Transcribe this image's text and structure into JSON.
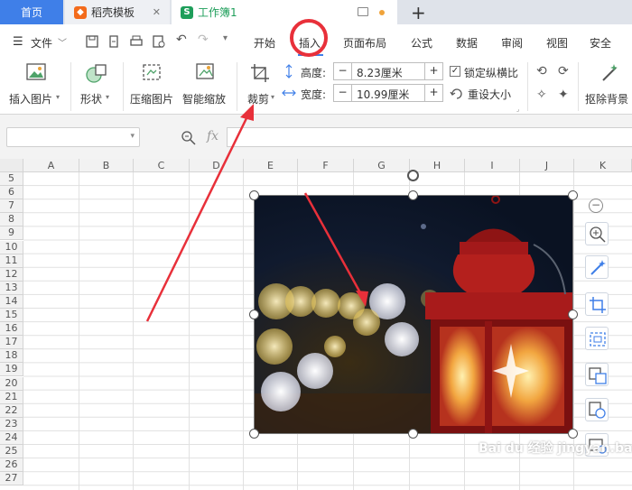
{
  "tabs": {
    "home": "首页",
    "template": "稻壳模板",
    "template_close": "✕",
    "workbook": "工作簿1",
    "new_tab": "+"
  },
  "menu": {
    "file": "文件",
    "items": [
      "开始",
      "插入",
      "页面布局",
      "公式",
      "数据",
      "审阅",
      "视图",
      "安全"
    ],
    "active_item": "插入"
  },
  "ribbon": {
    "insert_picture": "插入图片",
    "shape": "形状",
    "compress_picture": "压缩图片",
    "smart_zoom": "智能缩放",
    "crop": "裁剪",
    "height_label": "高度:",
    "height_value": "8.23厘米",
    "width_label": "宽度:",
    "width_value": "10.99厘米",
    "minus": "−",
    "plus": "+",
    "lock_ratio": "锁定纵横比",
    "lock_ratio_checked": true,
    "reset_size": "重设大小",
    "remove_background": "抠除背景"
  },
  "formula_bar": {
    "name_box_value": "",
    "fx_label": "fx"
  },
  "sheet": {
    "columns": [
      "A",
      "B",
      "C",
      "D",
      "E",
      "F",
      "G",
      "H",
      "I",
      "J",
      "K"
    ],
    "rows": [
      "5",
      "6",
      "7",
      "8",
      "9",
      "10",
      "11",
      "12",
      "13",
      "14",
      "15",
      "16",
      "17",
      "18",
      "19",
      "20",
      "21",
      "22",
      "23",
      "24",
      "25",
      "26",
      "27"
    ]
  },
  "watermark": "Bai du 经验  jingyan.baidu.com",
  "colors": {
    "accent": "#3f7fe8",
    "annotation_red": "#e8303a",
    "workbook_green": "#1e9e5a",
    "template_orange": "#f36b1c"
  }
}
